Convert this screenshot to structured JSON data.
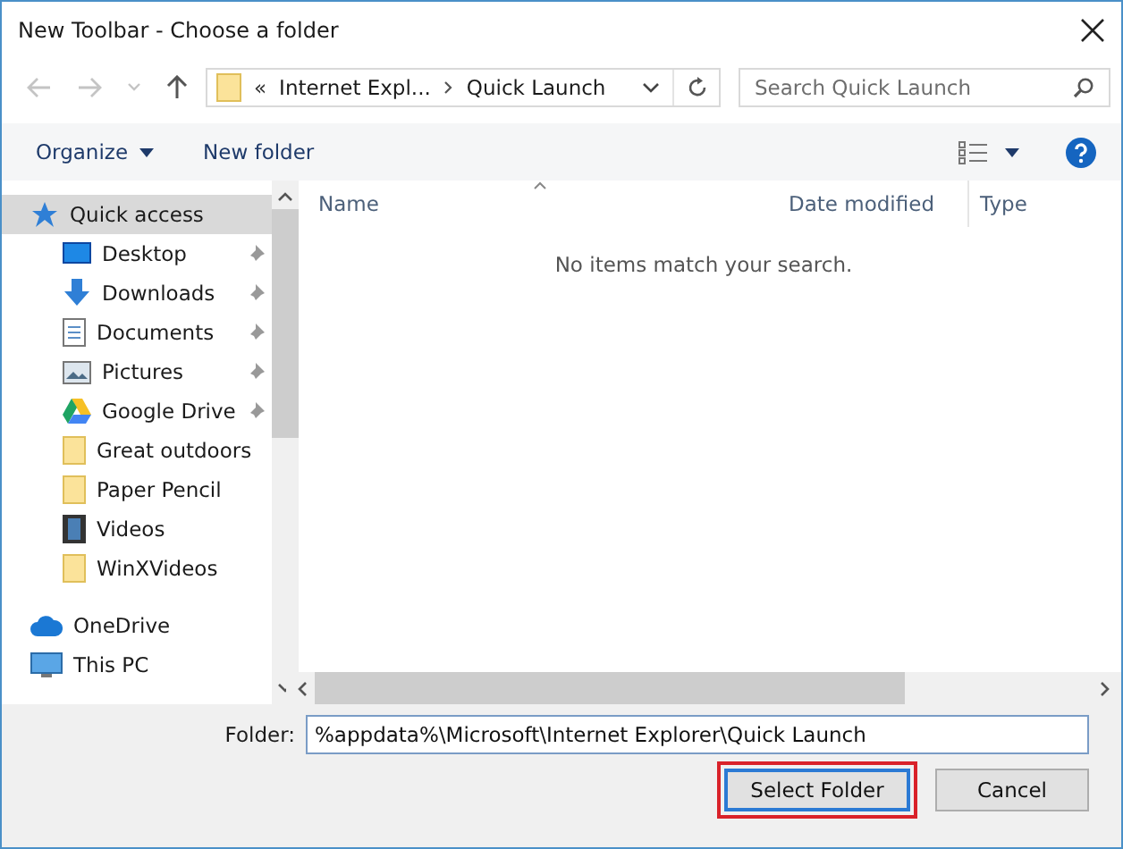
{
  "window": {
    "title": "New Toolbar - Choose a folder"
  },
  "address": {
    "overflow": "«",
    "crumbs": [
      "Internet Expl...",
      "Quick Launch"
    ]
  },
  "search": {
    "placeholder": "Search Quick Launch"
  },
  "commands": [
    "Organize",
    "New folder"
  ],
  "sidebar": {
    "items": [
      {
        "label": "Quick access",
        "kind": "star",
        "pinned": false,
        "selected": true,
        "indent": false
      },
      {
        "label": "Desktop",
        "kind": "desktop",
        "pinned": true,
        "selected": false,
        "indent": true
      },
      {
        "label": "Downloads",
        "kind": "download",
        "pinned": true,
        "selected": false,
        "indent": true
      },
      {
        "label": "Documents",
        "kind": "document",
        "pinned": true,
        "selected": false,
        "indent": true
      },
      {
        "label": "Pictures",
        "kind": "pictures",
        "pinned": true,
        "selected": false,
        "indent": true
      },
      {
        "label": "Google Drive",
        "kind": "drive",
        "pinned": true,
        "selected": false,
        "indent": true
      },
      {
        "label": "Great outdoors",
        "kind": "folder",
        "pinned": false,
        "selected": false,
        "indent": true
      },
      {
        "label": "Paper Pencil",
        "kind": "folder",
        "pinned": false,
        "selected": false,
        "indent": true
      },
      {
        "label": "Videos",
        "kind": "video",
        "pinned": false,
        "selected": false,
        "indent": true
      },
      {
        "label": "WinXVideos",
        "kind": "folder",
        "pinned": false,
        "selected": false,
        "indent": true
      },
      {
        "label": "OneDrive",
        "kind": "cloud",
        "pinned": false,
        "selected": false,
        "indent": false
      },
      {
        "label": "This PC",
        "kind": "pc",
        "pinned": false,
        "selected": false,
        "indent": false
      }
    ]
  },
  "table": {
    "columns": [
      "Name",
      "Date modified",
      "Type"
    ],
    "empty_message": "No items match your search."
  },
  "folder_field": {
    "label": "Folder:",
    "value": "%appdata%\\Microsoft\\Internet Explorer\\Quick Launch"
  },
  "buttons": [
    {
      "label": "Select Folder",
      "highlighted": true
    },
    {
      "label": "Cancel",
      "highlighted": false
    }
  ]
}
